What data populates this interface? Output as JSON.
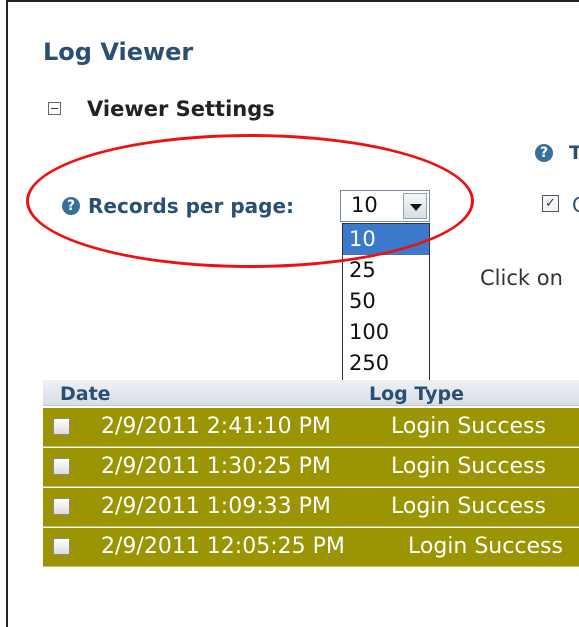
{
  "header": {
    "title": "Log Viewer"
  },
  "settings": {
    "section_title": "Viewer Settings",
    "help_right_text": "T",
    "records_per_page_label": "Records per page:",
    "records_per_page_value": "10",
    "options": [
      "10",
      "25",
      "50",
      "100",
      "250"
    ],
    "selected_option": "10",
    "right_checkbox_label": "C",
    "right_checkbox_checked": true,
    "click_hint": "Click on"
  },
  "grid": {
    "columns": [
      "Date",
      "Log Type"
    ],
    "rows": [
      {
        "date": "2/9/2011 2:41:10 PM",
        "type": "Login Success"
      },
      {
        "date": "2/9/2011 1:30:25 PM",
        "type": "Login Success"
      },
      {
        "date": "2/9/2011 1:09:33 PM",
        "type": "Login Success"
      },
      {
        "date": "2/9/2011 12:05:25 PM",
        "type": "Login Success"
      }
    ]
  },
  "colors": {
    "title_blue": "#2b4f72",
    "row_olive": "#9b9403",
    "selected_option_blue": "#3b79cc",
    "annotation_red": "#e11111"
  },
  "icons": [
    "collapse-icon",
    "help-icon",
    "dropdown-arrow-icon",
    "checkbox-icon"
  ]
}
